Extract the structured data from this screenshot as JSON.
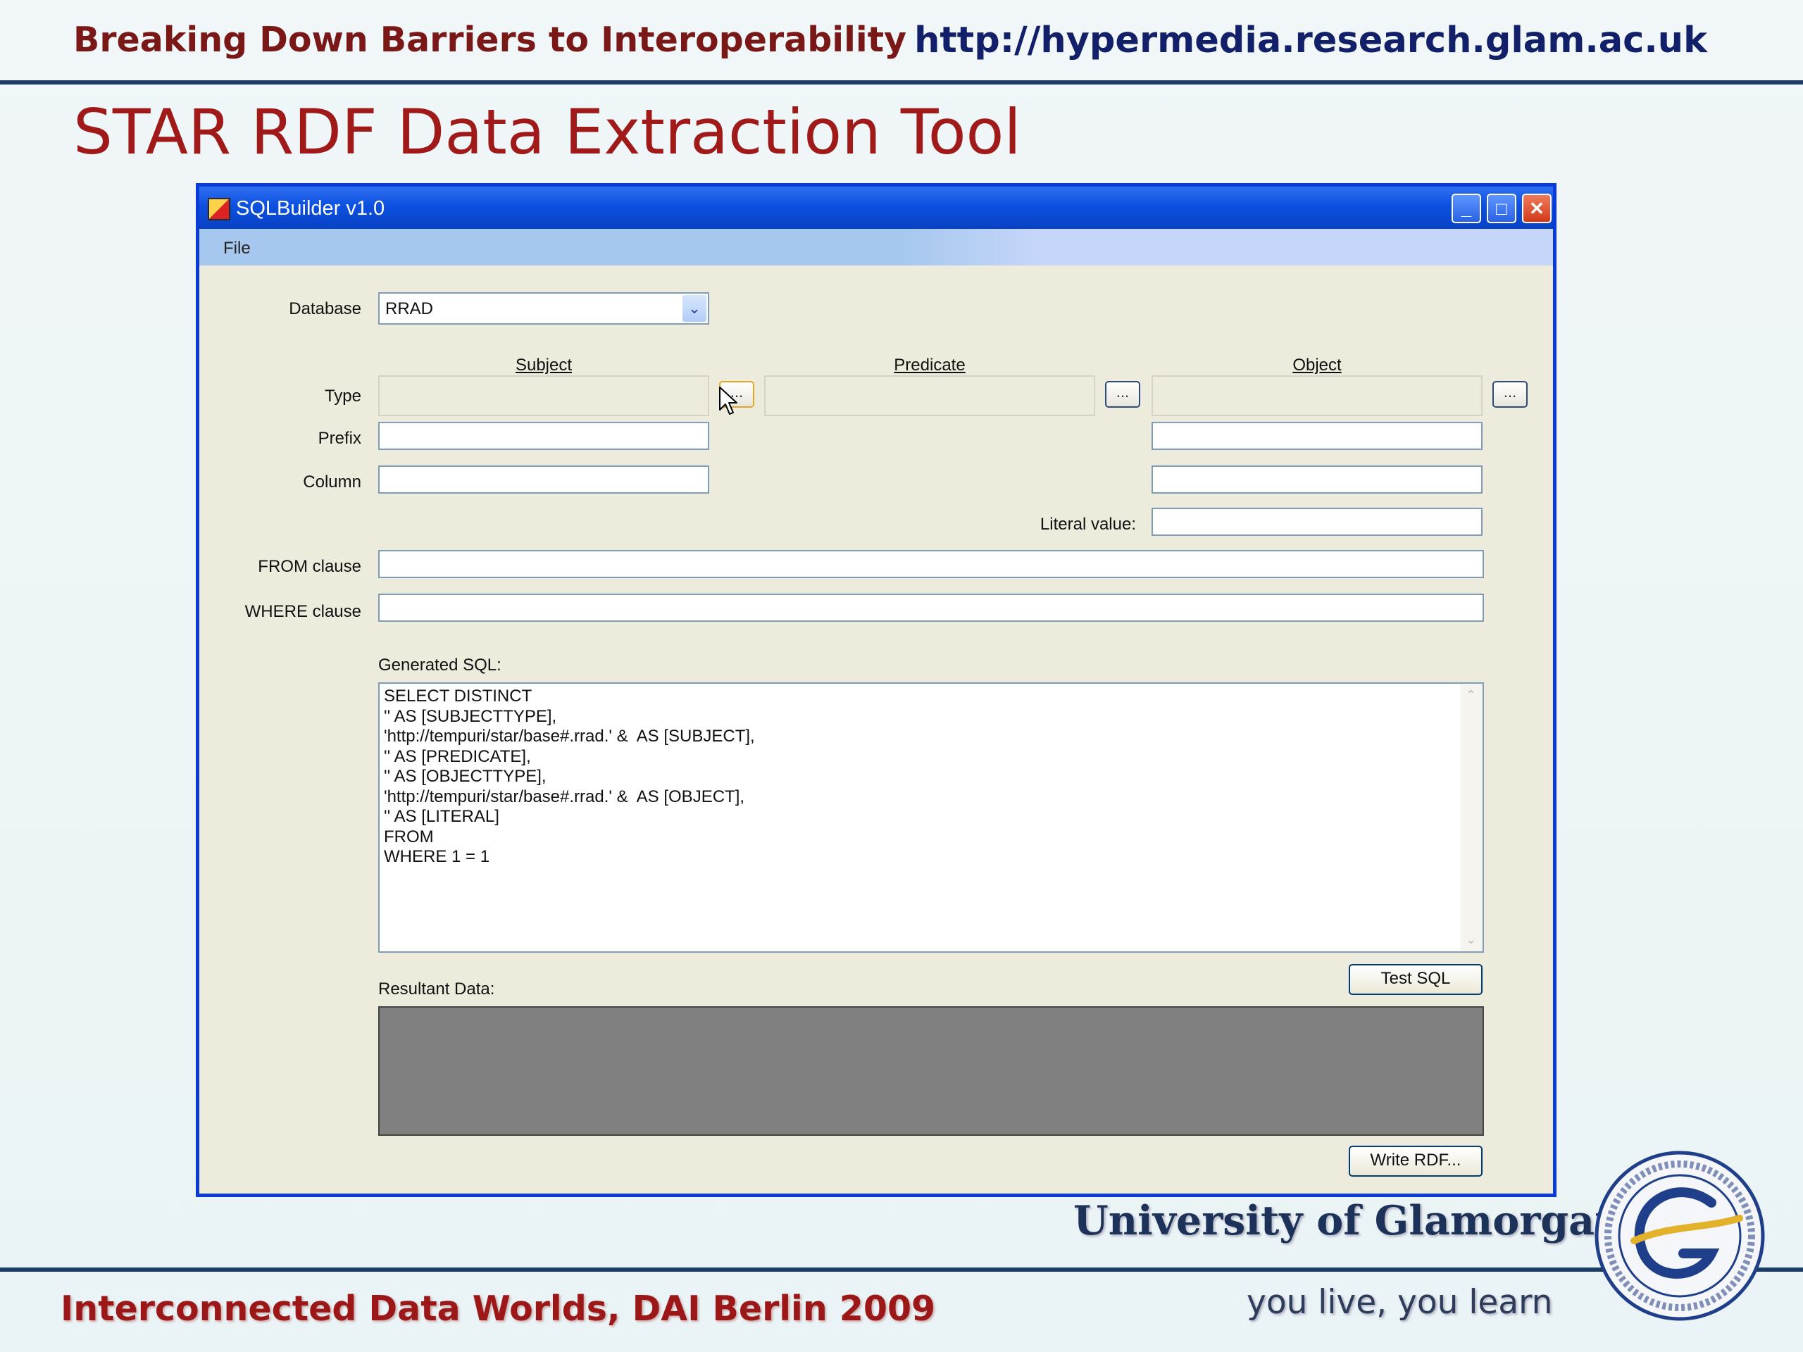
{
  "slide": {
    "header_title": "Breaking Down Barriers to Interoperability",
    "header_url": "http://hypermedia.research.glam.ac.uk",
    "title": "STAR RDF Data Extraction Tool",
    "footer": "Interconnected Data Worlds, DAI Berlin 2009",
    "university": "University of Glamorgan",
    "slogan": "you live, you learn",
    "logo_icon": "university-seal-icon"
  },
  "window": {
    "title": "SQLBuilder v1.0",
    "controls": {
      "minimize": "_",
      "maximize": "□",
      "close": "✕"
    },
    "menu": {
      "file": "File"
    }
  },
  "form": {
    "database_label": "Database",
    "database_value": "RRAD",
    "columns": {
      "subject": "Subject",
      "predicate": "Predicate",
      "object": "Object"
    },
    "type_label": "Type",
    "prefix_label": "Prefix",
    "column_label": "Column",
    "literal_label": "Literal value:",
    "from_label": "FROM clause",
    "where_label": "WHERE clause",
    "browse_button": "...",
    "fields": {
      "subject_type": "",
      "predicate_type": "",
      "object_type": "",
      "subject_prefix": "",
      "object_prefix": "",
      "subject_column": "",
      "object_column": "",
      "literal_value": "",
      "from_clause": "",
      "where_clause": ""
    }
  },
  "sql": {
    "label": "Generated SQL:",
    "text": "SELECT DISTINCT\n'' AS [SUBJECTTYPE],\n'http://tempuri/star/base#.rrad.' &  AS [SUBJECT],\n'' AS [PREDICATE],\n'' AS [OBJECTTYPE],\n'http://tempuri/star/base#.rrad.' &  AS [OBJECT],\n'' AS [LITERAL]\nFROM\nWHERE 1 = 1"
  },
  "results": {
    "label": "Resultant Data:"
  },
  "buttons": {
    "test_sql": "Test SQL",
    "write_rdf": "Write RDF..."
  },
  "colors": {
    "header_title": "#7a1818",
    "header_url": "#12206a",
    "slide_title": "#a11a1a",
    "window_border": "#0a3bd4",
    "window_face": "#ecebdc"
  }
}
